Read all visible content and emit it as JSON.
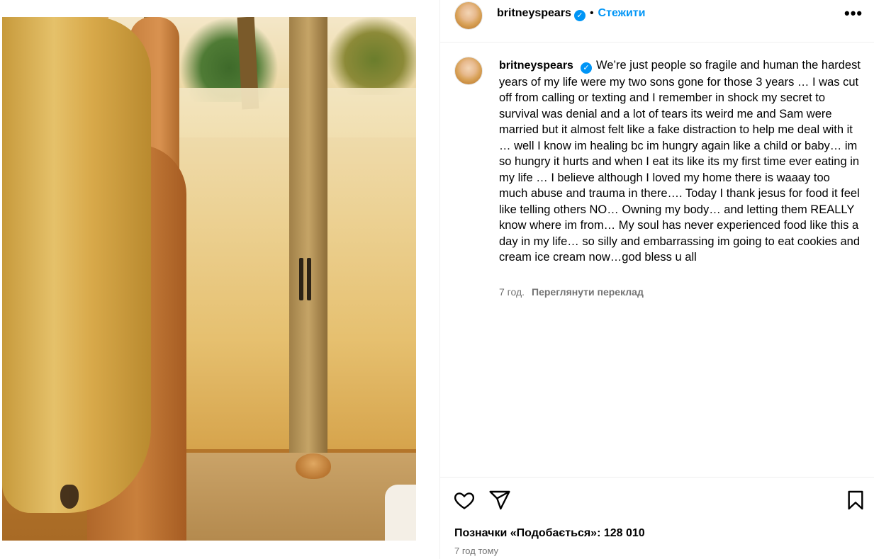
{
  "post": {
    "username": "britneyspears",
    "verified_mark": "✓",
    "separator": "•",
    "follow_label": "Стежити",
    "more_label": "•••"
  },
  "caption": {
    "username": "britneyspears",
    "text": "We’re just people so fragile and human the hardest years of my life were my two sons gone for those 3 years … I was cut off from calling or texting and I remember in shock my secret to survival was denial and a lot of tears its weird me and Sam were married but it almost felt like a fake distraction to help me deal with it … well I know im healing bc im hungry again like a child or baby… im so hungry it hurts and when I eat its like its my first time ever eating in my life … I believe although I loved my home there is waaay too much abuse and trauma in there…. Today I thank jesus for food it feel like telling others NO… Owning my body… and letting them REALLY know where im from… My soul has never experienced food like this a day in my life… so silly and embarrassing im going to eat cookies and cream ice cream now…god bless u all",
    "time": "7 год.",
    "translate_label": "Переглянути переклад"
  },
  "actions": {
    "like_icon": "heart-icon",
    "share_icon": "paper-plane-icon",
    "save_icon": "bookmark-icon",
    "likes_text": "Позначки «Подобається»: 128 010",
    "time_ago": "7 год тому"
  },
  "colors": {
    "accent": "#0095f6",
    "secondary_text": "#737373",
    "divider": "#efefef"
  }
}
